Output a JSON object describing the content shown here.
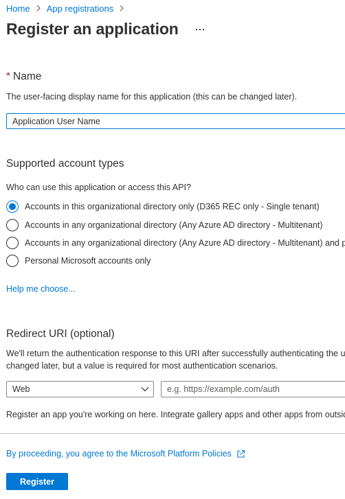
{
  "breadcrumb": {
    "home": "Home",
    "app_registrations": "App registrations"
  },
  "page": {
    "title": "Register an application"
  },
  "name_section": {
    "required_mark": "*",
    "title": "Name",
    "description": "The user-facing display name for this application (this can be changed later).",
    "value": "Application User Name"
  },
  "account_types": {
    "title": "Supported account types",
    "question": "Who can use this application or access this API?",
    "options": [
      {
        "label": "Accounts in this organizational directory only (D365 REC only - Single tenant)",
        "selected": true
      },
      {
        "label": "Accounts in any organizational directory (Any Azure AD directory - Multitenant)",
        "selected": false
      },
      {
        "label": "Accounts in any organizational directory (Any Azure AD directory - Multitenant) and personal Microsoft accounts (e.g. Skype, Xbox)",
        "selected": false
      },
      {
        "label": "Personal Microsoft accounts only",
        "selected": false
      }
    ],
    "help_link": "Help me choose..."
  },
  "redirect": {
    "title": "Redirect URI (optional)",
    "description_line1": "We'll return the authentication response to this URI after successfully authenticating the user. Providing this now is optional and it can be",
    "description_line2": "changed later, but a value is required for most authentication scenarios.",
    "platform_value": "Web",
    "uri_placeholder": "e.g. https://example.com/auth"
  },
  "gallery_note": "Register an app you're working on here. Integrate gallery apps and other apps from outside your organization by adding from Enterprise applications.",
  "policy_link": "By proceeding, you agree to the Microsoft Platform Policies",
  "register_label": "Register",
  "colors": {
    "accent": "#0078d4",
    "required": "#a4262c",
    "text": "#323130"
  }
}
